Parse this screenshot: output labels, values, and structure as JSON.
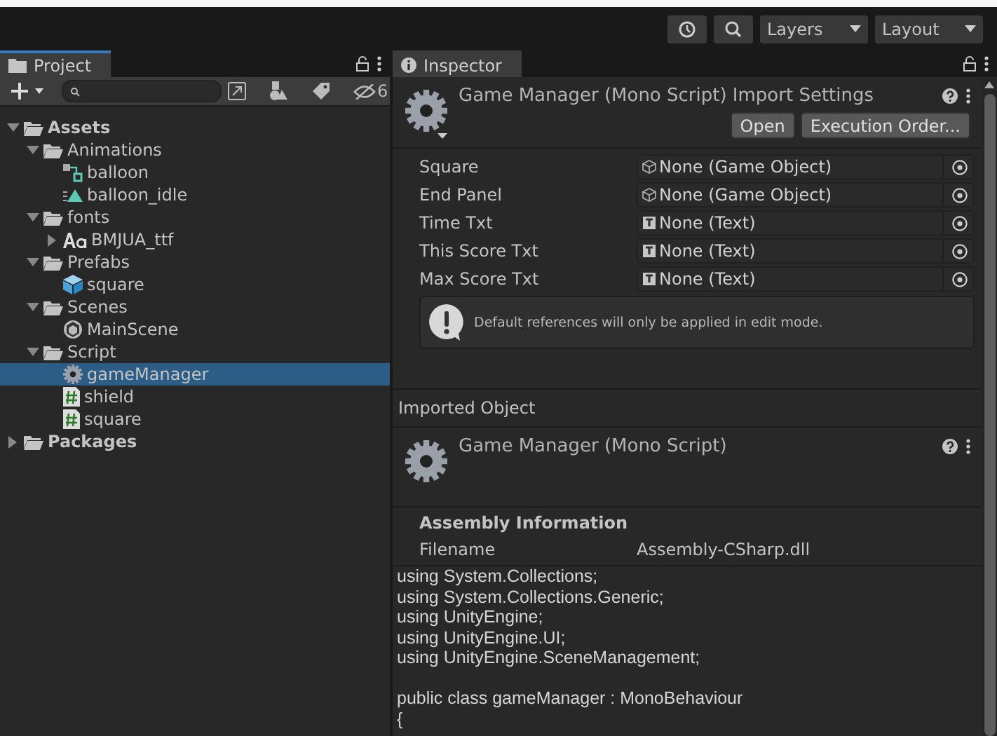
{
  "toolbar": {
    "dropdowns": [
      "Layers",
      "Layout"
    ]
  },
  "project": {
    "tab": "Project",
    "hidden_count": "6",
    "tree": [
      {
        "label": "Assets",
        "kind": "folder",
        "bold": true,
        "expanded": true,
        "selected": false,
        "children": [
          {
            "label": "Animations",
            "kind": "folder",
            "expanded": true,
            "selected": false,
            "children": [
              {
                "label": "balloon",
                "kind": "animator",
                "selected": false
              },
              {
                "label": "balloon_idle",
                "kind": "animation",
                "selected": false
              }
            ]
          },
          {
            "label": "fonts",
            "kind": "folder",
            "expanded": true,
            "selected": false,
            "children": [
              {
                "label": "BMJUA_ttf",
                "kind": "font",
                "expanded": false,
                "selected": false
              }
            ]
          },
          {
            "label": "Prefabs",
            "kind": "folder",
            "expanded": true,
            "selected": false,
            "children": [
              {
                "label": "square",
                "kind": "prefab",
                "selected": false
              }
            ]
          },
          {
            "label": "Scenes",
            "kind": "folder",
            "expanded": true,
            "selected": false,
            "children": [
              {
                "label": "MainScene",
                "kind": "scene",
                "selected": false
              }
            ]
          },
          {
            "label": "Script",
            "kind": "folder",
            "expanded": true,
            "selected": false,
            "children": [
              {
                "label": "gameManager",
                "kind": "gear",
                "selected": true
              },
              {
                "label": "shield",
                "kind": "script",
                "selected": false
              },
              {
                "label": "square",
                "kind": "script",
                "selected": false
              }
            ]
          }
        ]
      },
      {
        "label": "Packages",
        "kind": "folder",
        "bold": true,
        "expanded": false,
        "selected": false
      }
    ]
  },
  "inspector": {
    "tab": "Inspector",
    "title": "Game Manager (Mono Script) Import Settings",
    "buttons": [
      "Open",
      "Execution Order..."
    ],
    "fields": [
      {
        "label": "Square",
        "value": "None (Game Object)",
        "kind": "object"
      },
      {
        "label": "End Panel",
        "value": "None (Game Object)",
        "kind": "object"
      },
      {
        "label": "Time Txt",
        "value": "None (Text)",
        "kind": "text"
      },
      {
        "label": "This Score Txt",
        "value": "None (Text)",
        "kind": "text"
      },
      {
        "label": "Max Score Txt",
        "value": "None (Text)",
        "kind": "text"
      }
    ],
    "help": "Default references will only be applied in edit mode.",
    "imported_heading": "Imported Object",
    "object_title": "Game Manager (Mono Script)",
    "assembly": {
      "heading": "Assembly Information",
      "label": "Filename",
      "value": "Assembly-CSharp.dll"
    },
    "code": "using System.Collections;\nusing System.Collections.Generic;\nusing UnityEngine;\nusing UnityEngine.UI;\nusing UnityEngine.SceneManagement;\n\npublic class gameManager : MonoBehaviour\n{"
  }
}
